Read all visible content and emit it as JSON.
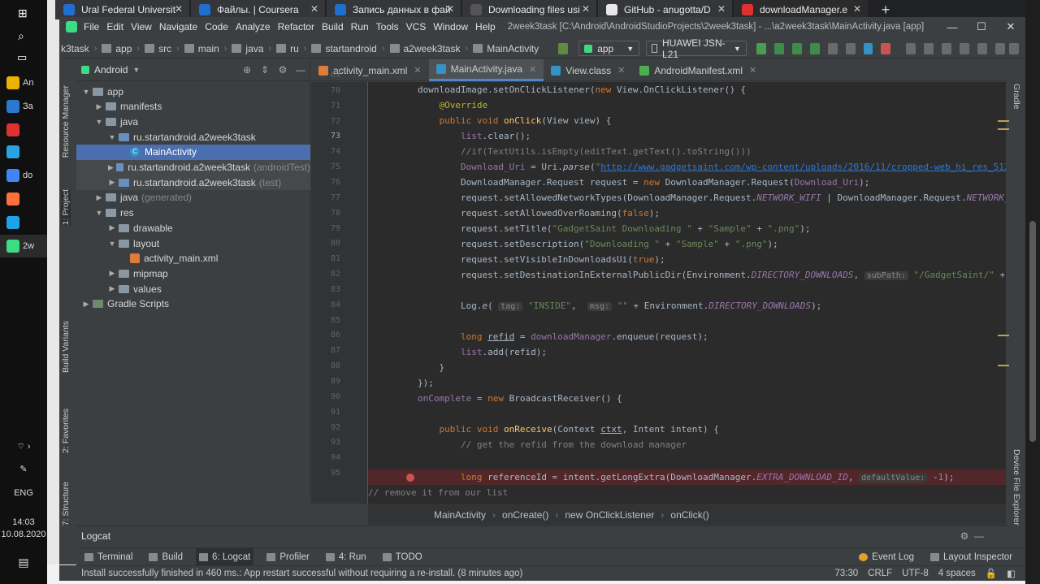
{
  "taskbar": {
    "items": [
      {
        "label": "An",
        "color": "#e9b300"
      },
      {
        "label": "За",
        "color": "#2b78d0"
      },
      {
        "label": "",
        "color": "#e03131"
      },
      {
        "label": "",
        "color": "#2aa3e0"
      },
      {
        "label": "do",
        "color": "#4285f4"
      },
      {
        "label": "",
        "color": "#ff7139"
      },
      {
        "label": "",
        "color": "#1fa2e8"
      },
      {
        "label": "2w",
        "color": "#3ddc84"
      }
    ],
    "lang": "ENG",
    "time": "14:03",
    "date": "10.08.2020"
  },
  "browser": {
    "tabs": [
      {
        "title": "Ural Federal Universit",
        "color": "#1f6fd1"
      },
      {
        "title": "Файлы. | Coursera",
        "color": "#1f6fd1"
      },
      {
        "title": "Запись данных в фай",
        "color": "#1f6fd1"
      },
      {
        "title": "Downloading files usi",
        "color": "#555555"
      },
      {
        "title": "GitHub - anugotta/D",
        "color": "#e8e8e8"
      },
      {
        "title": "downloadManager.e",
        "color": "#e03131"
      }
    ],
    "new_tab": "+"
  },
  "ide": {
    "menu": [
      "File",
      "Edit",
      "View",
      "Navigate",
      "Code",
      "Analyze",
      "Refactor",
      "Build",
      "Run",
      "Tools",
      "VCS",
      "Window",
      "Help"
    ],
    "title": "2week3task [C:\\Android\\AndroidStudioProjects\\2week3task] - ...\\a2week3task\\MainActivity.java [app]",
    "nav": [
      "k3task",
      "app",
      "src",
      "main",
      "java",
      "ru",
      "startandroid",
      "a2week3task",
      "MainActivity"
    ],
    "run_config": "app",
    "device": "HUAWEI JSN-L21",
    "project_view": "Android",
    "tree": [
      {
        "label": "app",
        "depth": 0,
        "arrow": "▼",
        "type": "fold"
      },
      {
        "label": "manifests",
        "depth": 1,
        "arrow": "▶",
        "type": "fold"
      },
      {
        "label": "java",
        "depth": 1,
        "arrow": "▼",
        "type": "fold"
      },
      {
        "label": "ru.startandroid.a2week3task",
        "depth": 2,
        "arrow": "▼",
        "type": "src"
      },
      {
        "label": "MainActivity",
        "depth": 3,
        "arrow": "",
        "type": "cls",
        "selected": true
      },
      {
        "label": "ru.startandroid.a2week3task",
        "depth": 2,
        "arrow": "▶",
        "type": "src",
        "suffix": "(androidTest)"
      },
      {
        "label": "ru.startandroid.a2week3task",
        "depth": 2,
        "arrow": "▶",
        "type": "src",
        "suffix": "(test)"
      },
      {
        "label": "java",
        "depth": 1,
        "arrow": "▶",
        "type": "fold",
        "suffix": "(generated)"
      },
      {
        "label": "res",
        "depth": 1,
        "arrow": "▼",
        "type": "res"
      },
      {
        "label": "drawable",
        "depth": 2,
        "arrow": "▶",
        "type": "fold"
      },
      {
        "label": "layout",
        "depth": 2,
        "arrow": "▼",
        "type": "fold"
      },
      {
        "label": "activity_main.xml",
        "depth": 3,
        "arrow": "",
        "type": "xml"
      },
      {
        "label": "mipmap",
        "depth": 2,
        "arrow": "▶",
        "type": "fold"
      },
      {
        "label": "values",
        "depth": 2,
        "arrow": "▶",
        "type": "fold"
      },
      {
        "label": "Gradle Scripts",
        "depth": 0,
        "arrow": "▶",
        "type": "gradle"
      }
    ],
    "editor_tabs": [
      {
        "label": "activity_main.xml",
        "color": "#e07b39"
      },
      {
        "label": "MainActivity.java",
        "color": "#3592c4",
        "active": true
      },
      {
        "label": "View.class",
        "color": "#3592c4"
      },
      {
        "label": "AndroidManifest.xml",
        "color": "#4caf50"
      }
    ],
    "left_strip": [
      "Resource Manager",
      "1: Project",
      "Build Variants",
      "2: Favorites",
      "7: Structure"
    ],
    "right_strip": [
      "Gradle",
      "Device File Explorer"
    ],
    "line_numbers": [
      "69",
      "70",
      "71",
      "72",
      "73",
      "74",
      "75",
      "76",
      "77",
      "78",
      "79",
      "80",
      "81",
      "82",
      "83",
      "84",
      "85",
      "86",
      "87",
      "88",
      "89",
      "90",
      "91",
      "92",
      "93",
      "94",
      "95"
    ],
    "breadcrumbs": [
      "MainActivity",
      "onCreate()",
      "new OnClickListener",
      "onClick()"
    ],
    "logcat_label": "Logcat",
    "tool_windows": [
      "Terminal",
      "Build",
      "6: Logcat",
      "Profiler",
      "4: Run",
      "TODO"
    ],
    "tool_windows_right": [
      "Event Log",
      "Layout Inspector"
    ],
    "status_message": "Install successfully finished in 460 ms.: App restart successful without requiring a re-install. (8 minutes ago)",
    "status_right": [
      "73:30",
      "CRLF",
      "UTF-8",
      "4 spaces"
    ]
  }
}
